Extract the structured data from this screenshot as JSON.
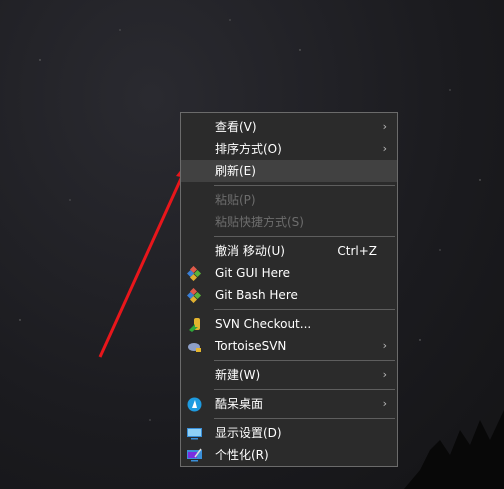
{
  "menu": {
    "view": "查看(V)",
    "sort": "排序方式(O)",
    "refresh": "刷新(E)",
    "paste": "粘贴(P)",
    "paste_shortcut": "粘贴快捷方式(S)",
    "undo": "撤消 移动(U)",
    "undo_shortcut": "Ctrl+Z",
    "git_gui": "Git GUI Here",
    "git_bash": "Git Bash Here",
    "svn_checkout": "SVN Checkout...",
    "tortoise": "TortoiseSVN",
    "new": "新建(W)",
    "kudai": "酷呆桌面",
    "display": "显示设置(D)",
    "personalize": "个性化(R)",
    "chevron": "›"
  },
  "colors": {
    "arrow": "#e8161b",
    "highlight": "#414141"
  }
}
